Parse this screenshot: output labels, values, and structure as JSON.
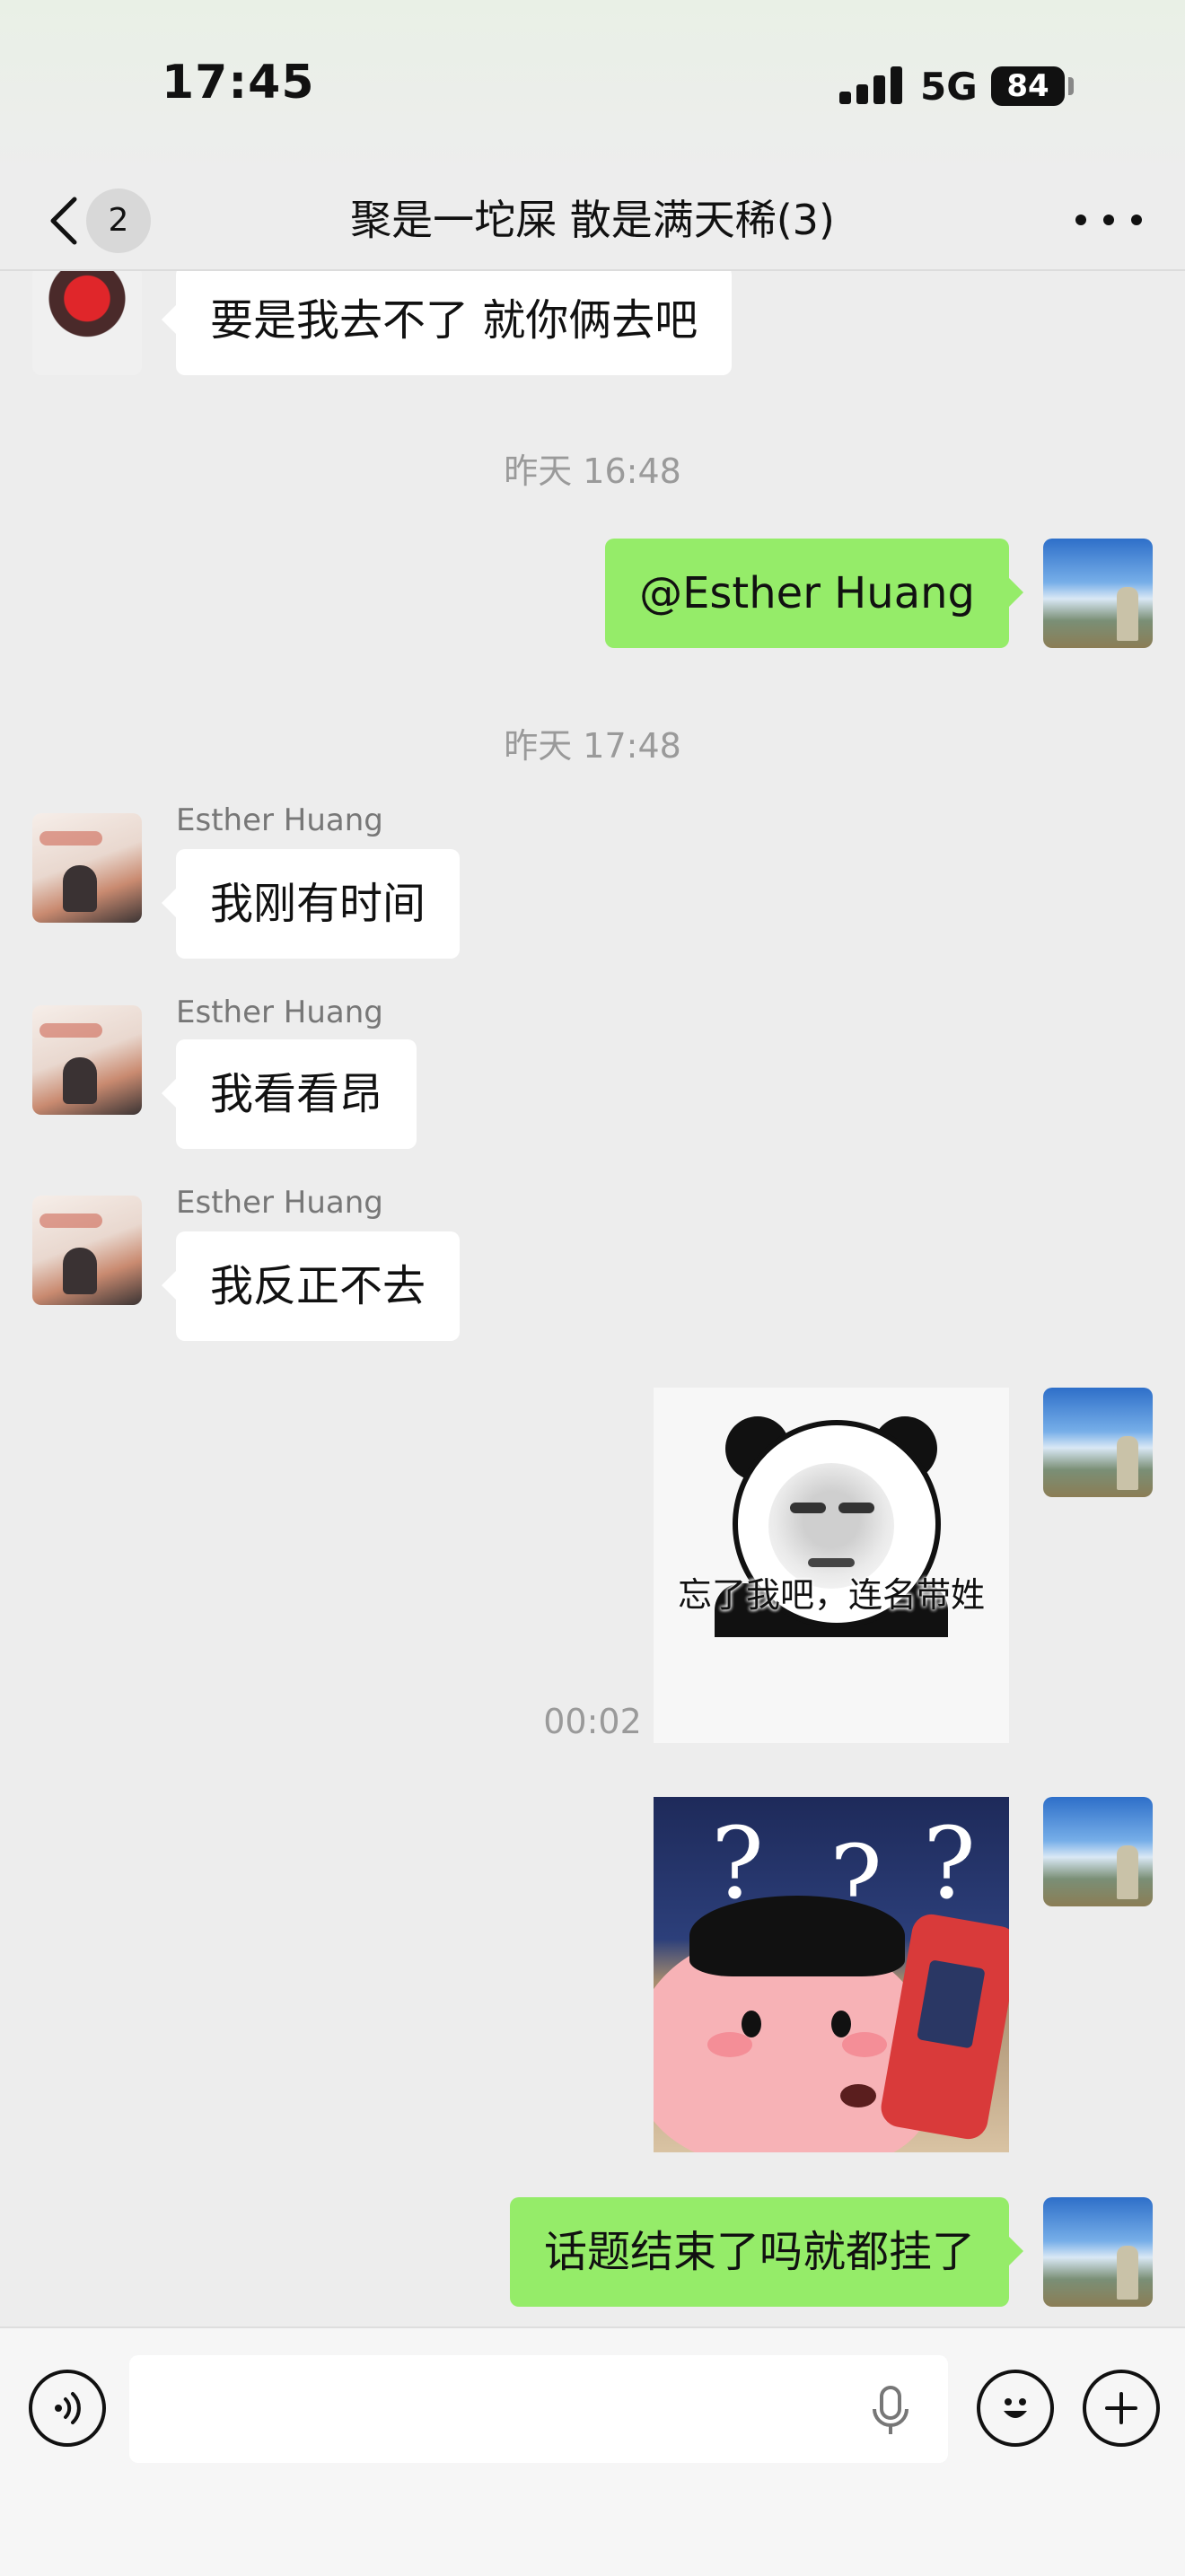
{
  "status_bar": {
    "time": "17:45",
    "network": "5G",
    "battery": "84"
  },
  "nav": {
    "unread_count": "2",
    "title": "聚是一坨屎 散是满天稀(3)"
  },
  "messages": {
    "m1_text": "要是我去不了  就你俩去吧",
    "t1": "昨天 16:48",
    "m2_text": "@Esther Huang",
    "t2": "昨天 17:48",
    "m3_sender": "Esther Huang",
    "m3_text": "我刚有时间",
    "m4_sender": "Esther Huang",
    "m4_text": "我看看昂",
    "m5_sender": "Esther Huang",
    "m5_text": "我反正不去",
    "sticker1_caption": "忘了我吧，连名带姓",
    "t3": "00:02",
    "m8_text": "话题结束了吗就都挂了"
  },
  "sticker2_marks": [
    "?",
    "?",
    "?"
  ],
  "input": {
    "placeholder": ""
  },
  "icons": {
    "back": "chevron-left-icon",
    "more": "ellipsis-icon",
    "voice": "voice-icon",
    "mic": "microphone-icon",
    "emoji": "emoji-icon",
    "plus": "plus-icon"
  },
  "colors": {
    "my_bubble": "#95ec69",
    "other_bubble": "#ffffff",
    "background": "#ededed"
  }
}
